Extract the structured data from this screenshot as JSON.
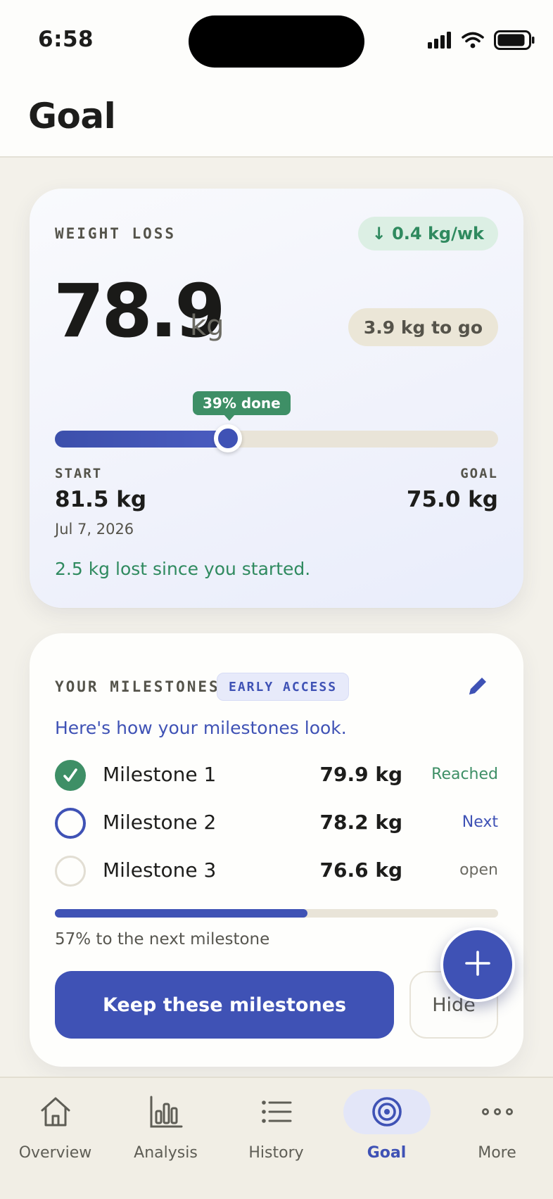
{
  "status_bar": {
    "time": "6:58"
  },
  "header": {
    "title": "Goal"
  },
  "weight_card": {
    "eyebrow": "WEIGHT LOSS",
    "rate": "↓ 0.4 kg/wk",
    "current_value": "78.9",
    "unit": "kg",
    "to_go": "3.9 kg to go",
    "progress_label": "39% done",
    "progress_fraction": 0.39,
    "start_label": "START",
    "start_value": "81.5 kg",
    "start_date": "Jul 7, 2026",
    "goal_label": "GOAL",
    "goal_value": "75.0 kg",
    "lost_text": "2.5 kg lost since you started."
  },
  "milestones": {
    "eyebrow": "YOUR MILESTONES",
    "badge": "EARLY ACCESS",
    "intro": "Here's how your milestones look.",
    "items": [
      {
        "name": "Milestone 1",
        "value": "79.9 kg",
        "status": "Reached",
        "state": "reached"
      },
      {
        "name": "Milestone 2",
        "value": "78.2 kg",
        "status": "Next",
        "state": "next"
      },
      {
        "name": "Milestone 3",
        "value": "76.6 kg",
        "status": "open",
        "state": "open"
      }
    ],
    "progress_fraction": 0.57,
    "progress_text": "57% to the next milestone",
    "keep_label": "Keep these milestones",
    "hide_label": "Hide"
  },
  "fab": {
    "icon": "plus-icon"
  },
  "nav": {
    "items": [
      {
        "label": "Overview",
        "icon": "home-icon"
      },
      {
        "label": "Analysis",
        "icon": "bar-chart-icon"
      },
      {
        "label": "History",
        "icon": "list-icon"
      },
      {
        "label": "Goal",
        "icon": "target-icon",
        "active": true
      },
      {
        "label": "More",
        "icon": "more-icon"
      }
    ]
  },
  "colors": {
    "accent": "#3f52b5",
    "success": "#3e8f66",
    "background": "#f3f1ea"
  }
}
